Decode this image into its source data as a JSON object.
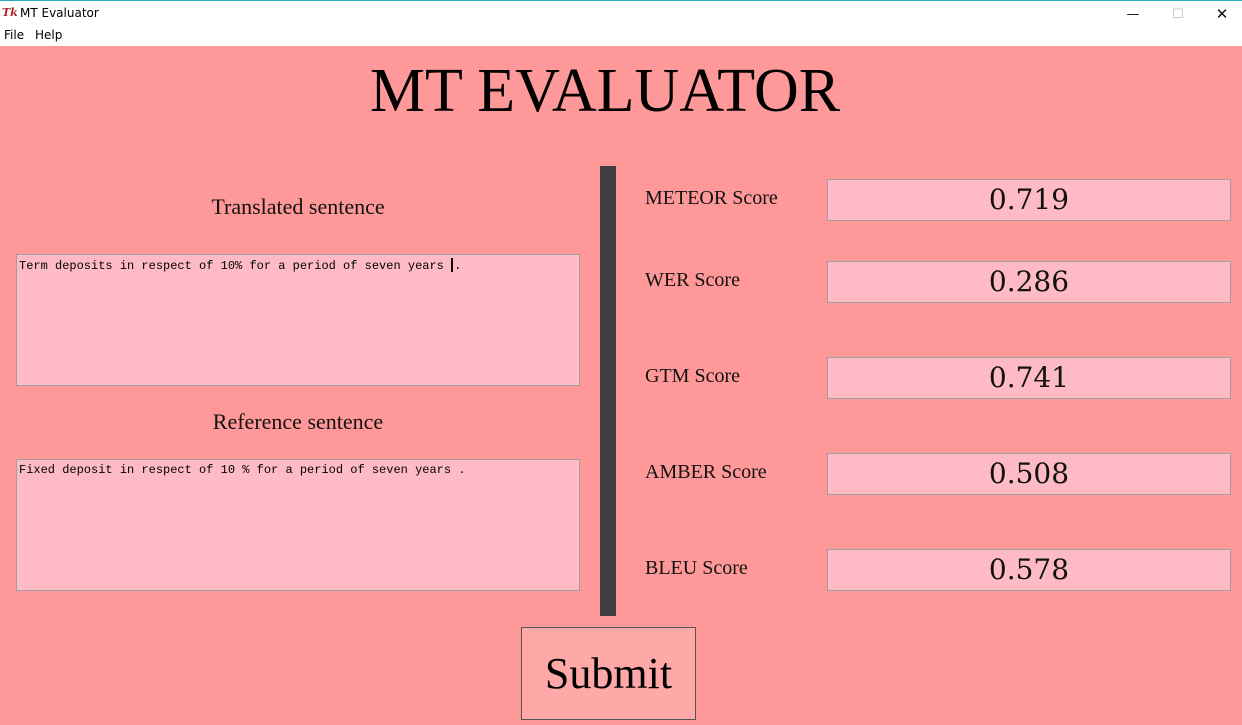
{
  "window": {
    "title": "MT Evaluator",
    "icon_label": "Tk",
    "controls": {
      "minimize": "—",
      "maximize": "☐",
      "close": "✕"
    }
  },
  "menu": {
    "file": "File",
    "help": "Help"
  },
  "heading": "MT EVALUATOR",
  "translated": {
    "label": "Translated sentence",
    "value": "Term deposits in respect of 10% for a period of seven years ",
    "value_tail": "."
  },
  "reference": {
    "label": "Reference sentence",
    "value": "Fixed deposit in respect of 10 % for a period of seven years ."
  },
  "scores": {
    "meteor": {
      "label": "METEOR Score",
      "value": "0.719"
    },
    "wer": {
      "label": "WER Score",
      "value": "0.286"
    },
    "gtm": {
      "label": "GTM Score",
      "value": "0.741"
    },
    "amber": {
      "label": "AMBER Score",
      "value": "0.508"
    },
    "bleu": {
      "label": "BLEU Score",
      "value": "0.578"
    }
  },
  "submit_label": "Submit",
  "colors": {
    "background": "#ff9999",
    "field": "#ffbbc5",
    "divider": "#3f3f3f"
  }
}
